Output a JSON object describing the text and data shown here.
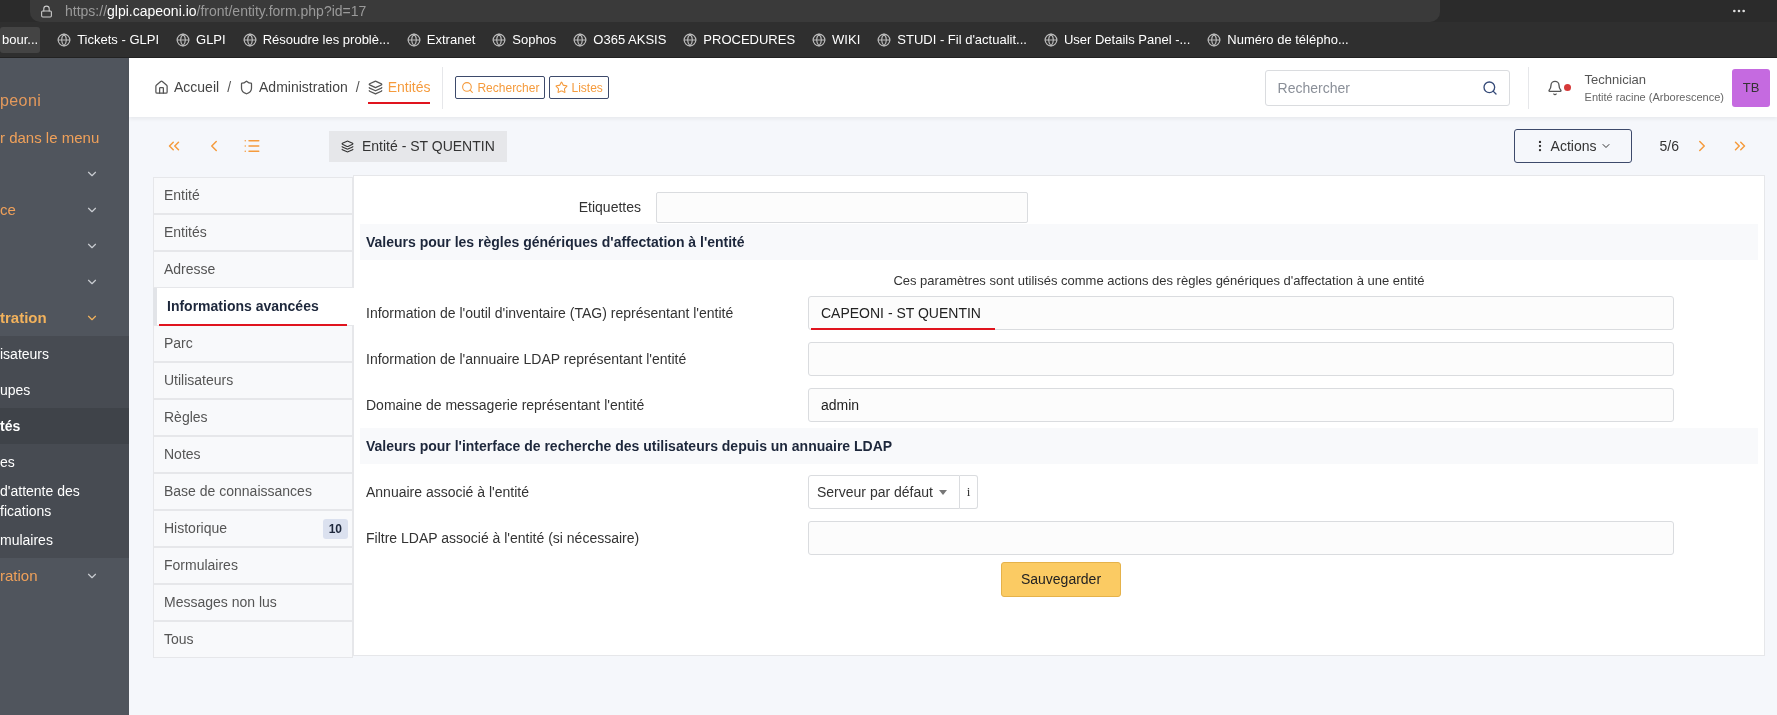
{
  "browser": {
    "url_prefix": "https://",
    "url_host": "glpi.capeoni.io",
    "url_path": "/front/entity.form.php?id=17",
    "bookmarks": [
      "bour...",
      "Tickets - GLPI",
      "GLPI",
      "Résoudre les problè...",
      "Extranet",
      "Sophos",
      "O365 AKSIS",
      "PROCEDURES",
      "WIKI",
      "STUDI - Fil d'actualit...",
      "User Details Panel -...",
      "Numéro de télépho..."
    ]
  },
  "sidebar": {
    "logo_text": "peoni",
    "search_link": "r dans le menu",
    "items": [
      {
        "kind": "group",
        "selected": false
      },
      {
        "kind": "group",
        "label": "ce",
        "selected": false
      },
      {
        "kind": "group",
        "selected": false
      },
      {
        "kind": "group",
        "selected": false
      },
      {
        "kind": "group",
        "label": "tration",
        "selected": true
      },
      {
        "kind": "sub",
        "label": "isateurs",
        "selected": false
      },
      {
        "kind": "sub",
        "label": "upes",
        "selected": false
      },
      {
        "kind": "sub",
        "label": "tés",
        "selected": true
      },
      {
        "kind": "sub",
        "label": "es",
        "selected": false
      },
      {
        "kind": "sub",
        "label": "d'attente des fications",
        "selected": false
      },
      {
        "kind": "sub",
        "label": "mulaires",
        "selected": false
      },
      {
        "kind": "group",
        "label": "ration",
        "selected": false
      }
    ]
  },
  "header": {
    "separator": "/",
    "breadcrumbs": [
      {
        "label": "Accueil",
        "kind": "home"
      },
      {
        "label": "Administration",
        "kind": "shield"
      },
      {
        "label": "Entités",
        "kind": "layers"
      }
    ],
    "buttons": [
      {
        "label": "Rechercher",
        "kind": "search"
      },
      {
        "label": "Listes",
        "kind": "star"
      }
    ],
    "search": {
      "placeholder": "Rechercher"
    },
    "user": {
      "name": "Technician",
      "entity": "Entité racine (Arborescence)",
      "initials": "TB"
    }
  },
  "record": {
    "title": "Entité - ST QUENTIN",
    "actions": "Actions",
    "position": "5/6"
  },
  "tabs": [
    {
      "label": "Entité",
      "selected": false
    },
    {
      "label": "Entités",
      "selected": false
    },
    {
      "label": "Adresse",
      "selected": false
    },
    {
      "label": "Informations avancées",
      "selected": true
    },
    {
      "label": "Parc",
      "selected": false
    },
    {
      "label": "Utilisateurs",
      "selected": false
    },
    {
      "label": "Règles",
      "selected": false
    },
    {
      "label": "Notes",
      "selected": false
    },
    {
      "label": "Base de connaissances",
      "selected": false
    },
    {
      "label": "Historique",
      "selected": false,
      "count": "10"
    },
    {
      "label": "Formulaires",
      "selected": false
    },
    {
      "label": "Messages non lus",
      "selected": false
    },
    {
      "label": "Tous",
      "selected": false
    }
  ],
  "form": {
    "tags_label": "Etiquettes",
    "sections": [
      {
        "title": "Valeurs pour les règles génériques d'affectation à l'entité",
        "note": "Ces paramètres sont utilisés comme actions des règles génériques d'affectation à une entité",
        "fields": [
          {
            "kind": "text",
            "label": "Information de l'outil d'inventaire (TAG) représentant l'entité",
            "value": "CAPEONI - ST QUENTIN"
          },
          {
            "kind": "text",
            "label": "Information de l'annuaire LDAP représentant l'entité"
          },
          {
            "kind": "text",
            "label": "Domaine de messagerie représentant l'entité",
            "value": "admin"
          }
        ]
      },
      {
        "title": "Valeurs pour l'interface de recherche des utilisateurs depuis un annuaire LDAP",
        "fields": [
          {
            "kind": "select",
            "label": "Annuaire associé à l'entité",
            "value": "Serveur par défaut",
            "info": "i"
          },
          {
            "kind": "text",
            "label": "Filtre LDAP associé à l'entité (si nécessaire)"
          }
        ]
      }
    ],
    "save": "Sauvegarder"
  }
}
